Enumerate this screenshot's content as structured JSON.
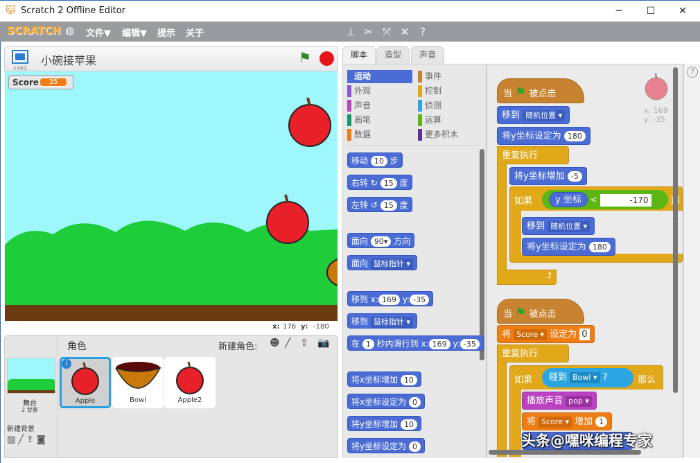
{
  "window": {
    "title": "Scratch 2 Offline Editor",
    "minimize": "─",
    "maximize": "☐",
    "close": "✕"
  },
  "menubar": {
    "logo": "SCRATCH",
    "items": [
      "文件▼",
      "编辑▼",
      "提示",
      "关于"
    ],
    "tool_icons": [
      "stamp-icon",
      "cut-icon",
      "grow-icon",
      "shrink-icon",
      "help-icon"
    ]
  },
  "stage": {
    "version": "v461",
    "project_title": "小碗接苹果",
    "monitor": {
      "label": "Score",
      "value": "35"
    },
    "mouse_x_label": "x:",
    "mouse_x": "176",
    "mouse_y_label": "y:",
    "mouse_y": "-180",
    "colors": {
      "sky": "#9ef7fb",
      "hills": "#1fcc3a",
      "ground": "#6b3a10"
    }
  },
  "sprites": {
    "header": "角色",
    "new_sprite": "新建角色:",
    "stage_label": "舞台",
    "stage_backdrops": "2 背景",
    "new_backdrop": "新建背景",
    "items": [
      {
        "name": "Apple",
        "selected": true
      },
      {
        "name": "Bowl"
      },
      {
        "name": "Apple2"
      }
    ]
  },
  "tabs": [
    "脚本",
    "造型",
    "声音"
  ],
  "categories": {
    "left": [
      {
        "label": "运动",
        "color": "#4a6cd4"
      },
      {
        "label": "外观",
        "color": "#8a55d7"
      },
      {
        "label": "声音",
        "color": "#bb42c3"
      },
      {
        "label": "画笔",
        "color": "#0e9a6c"
      },
      {
        "label": "数据",
        "color": "#ee7d16"
      }
    ],
    "right": [
      {
        "label": "事件",
        "color": "#c88330"
      },
      {
        "label": "控制",
        "color": "#e1a91a"
      },
      {
        "label": "侦测",
        "color": "#2ca5e2"
      },
      {
        "label": "运算",
        "color": "#5cb712"
      },
      {
        "label": "更多积木",
        "color": "#632d99"
      }
    ]
  },
  "palette": {
    "move": [
      "移动",
      "10",
      "步"
    ],
    "turn_right": [
      "右转",
      "15",
      "度"
    ],
    "turn_left": [
      "左转",
      "15",
      "度"
    ],
    "point_dir": [
      "面向",
      "90▾",
      "方向"
    ],
    "point_towards": [
      "面向",
      "鼠标指针 ▾"
    ],
    "goto_xy": [
      "移到",
      "x:",
      "169",
      "y:",
      "-35"
    ],
    "goto": [
      "移到",
      "鼠标指针 ▾"
    ],
    "glide": [
      "在",
      "1",
      "秒内滑行到",
      "x:",
      "169",
      "y:",
      "-35"
    ],
    "change_x": [
      "将x坐标增加",
      "10"
    ],
    "set_x": [
      "将x坐标设定为",
      "0"
    ],
    "change_y": [
      "将y坐标增加",
      "10"
    ],
    "set_y": [
      "将y坐标设定为",
      "0"
    ]
  },
  "scripts": {
    "sprite_x": "x: 169",
    "sprite_y": "y: -35",
    "s1": {
      "hat": [
        "当",
        "被点击"
      ],
      "goto": [
        "移到",
        "随机位置 ▾"
      ],
      "sety": [
        "将y坐标设定为",
        "180"
      ],
      "forever": "重复执行",
      "changey": [
        "将y坐标增加",
        "-5"
      ],
      "if": [
        "如果",
        "y 坐标",
        "<",
        "-170",
        "那么"
      ],
      "goto2": [
        "移到",
        "随机位置 ▾"
      ],
      "sety2": [
        "将y坐标设定为",
        "180"
      ]
    },
    "s2": {
      "hat": [
        "当",
        "被点击"
      ],
      "setvar": [
        "将",
        "Score ▾",
        "设定为",
        "0"
      ],
      "forever": "重复执行",
      "if": [
        "如果",
        "碰到",
        "Bowl ▾",
        "?",
        "那么"
      ],
      "play": [
        "播放声音",
        "pop ▾"
      ],
      "changevar": [
        "将",
        "Score ▾",
        "增加",
        "1"
      ]
    }
  },
  "watermark": "头条@嘿咪编程专家",
  "help_button": "?"
}
